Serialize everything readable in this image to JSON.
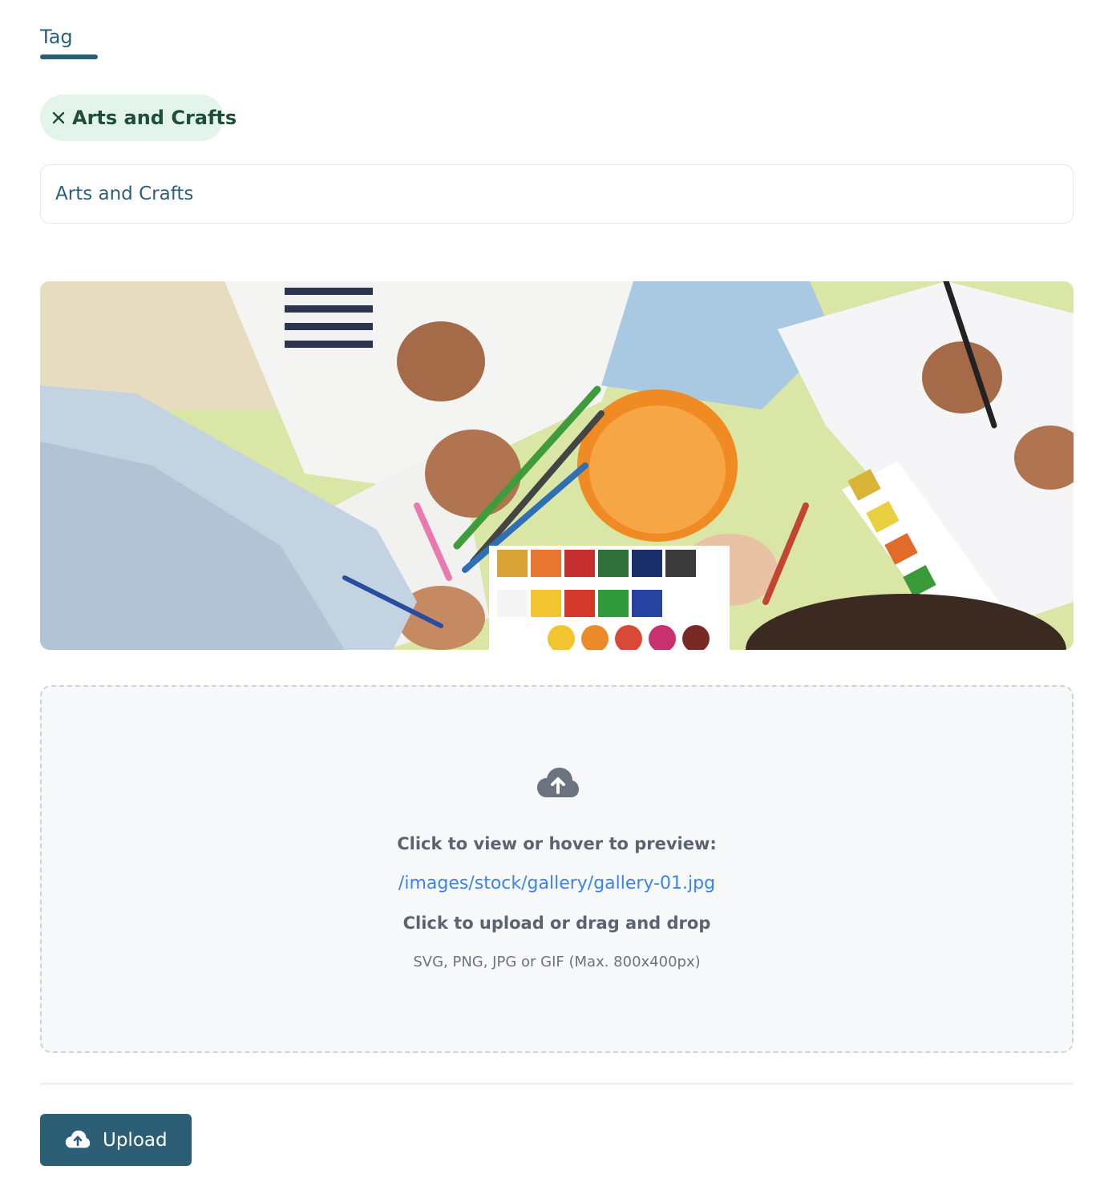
{
  "tabs": [
    {
      "label": "Tag",
      "active": true
    }
  ],
  "selected_tag": {
    "label": "Arts and Crafts",
    "remove_icon": "close-icon"
  },
  "tag_input": {
    "value": "Arts and Crafts"
  },
  "preview_image": {
    "description": "photo-children-painting-with-watercolors"
  },
  "dropzone": {
    "icon": "cloud-upload-icon",
    "prompt": "Click to view or hover to preview:",
    "file_path": "/images/stock/gallery/gallery-01.jpg",
    "upload_text": "Click to upload or drag and drop",
    "formats_text": "SVG, PNG, JPG or GIF (Max. 800x400px)"
  },
  "actions": {
    "upload_label": "Upload",
    "upload_icon": "cloud-upload-icon"
  },
  "colors": {
    "primary": "#2c5f75",
    "chip_bg": "#e3f4ea",
    "chip_text": "#1e4d3a",
    "link": "#3b82f6",
    "dropzone_bg": "#f7f8fa"
  }
}
